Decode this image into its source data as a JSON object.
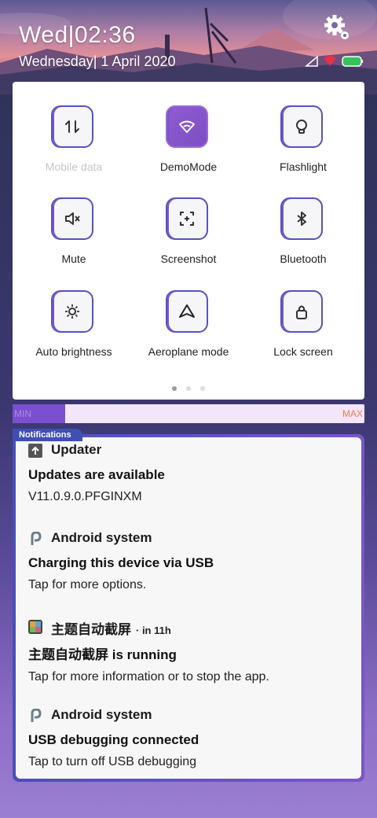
{
  "status_bar": {
    "time": "Wed|02:36",
    "date": "Wednesday| 1 April 2020",
    "icons": [
      "signal-icon",
      "wifi-icon",
      "battery-icon"
    ]
  },
  "quick_settings": {
    "tiles": [
      {
        "label": "Mobile data",
        "icon": "data-arrows-icon",
        "state": "disabled"
      },
      {
        "label": "DemoMode",
        "icon": "wifi-icon",
        "state": "active"
      },
      {
        "label": "Flashlight",
        "icon": "flashlight-icon",
        "state": "off"
      },
      {
        "label": "Mute",
        "icon": "mute-icon",
        "state": "off"
      },
      {
        "label": "Screenshot",
        "icon": "screenshot-icon",
        "state": "off"
      },
      {
        "label": "Bluetooth",
        "icon": "bluetooth-icon",
        "state": "off"
      },
      {
        "label": "Auto brightness",
        "icon": "brightness-icon",
        "state": "off"
      },
      {
        "label": "Aeroplane mode",
        "icon": "aeroplane-icon",
        "state": "off"
      },
      {
        "label": "Lock screen",
        "icon": "lock-icon",
        "state": "off"
      }
    ],
    "page_indicator": {
      "current": 1,
      "total": 3
    }
  },
  "brightness": {
    "min_label": "MIN",
    "max_label": "MAX",
    "level": 0.15
  },
  "notifications": {
    "tag": "Notifications",
    "items": [
      {
        "app": "Updater",
        "time": "",
        "title": "Updates are available",
        "text": "V11.0.9.0.PFGINXM",
        "icon": "updater-icon"
      },
      {
        "app": "Android system",
        "time": "",
        "title": "Charging this device via USB",
        "text": "Tap for more options.",
        "icon": "android-system-icon"
      },
      {
        "app": "主题自动截屏",
        "time": "· in 11h",
        "title": "主题自动截屏 is running",
        "text": "Tap for more information or to stop the app.",
        "icon": "theme-app-icon"
      },
      {
        "app": "Android system",
        "time": "",
        "title": "USB debugging connected",
        "text": "Tap to turn off USB debugging",
        "icon": "android-system-icon"
      }
    ]
  },
  "colors": {
    "accent": "#7a4fd0",
    "tile_border": "#5552c2",
    "tag": "#3f4fb4",
    "max_label": "#f07a4a"
  }
}
